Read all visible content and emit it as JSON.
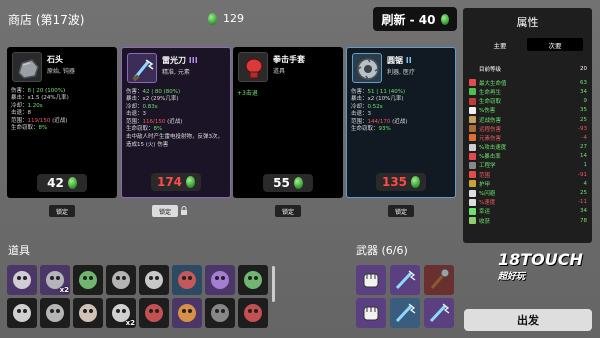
{
  "header": {
    "shop_title": "商店 (第17波)",
    "materials": "129",
    "reroll_label": "刷新 - 40"
  },
  "cards": [
    {
      "name": "石头",
      "tier": "",
      "tags": "原始, 钝器",
      "stats": [
        {
          "k": "伤害：",
          "v": "8 | 20",
          "tag": "(",
          "extra": "100%",
          "tail": ")"
        },
        {
          "k": "暴击：",
          "v": "x1.5",
          "extra": "(24%几率)"
        },
        {
          "k": "冷却：",
          "v": "1.20s"
        },
        {
          "k": "击退：",
          "v": "8"
        },
        {
          "k": "范围：",
          "v": "119/150",
          "extra": "(近战)"
        },
        {
          "k": "生命窃取：",
          "v": "8%"
        }
      ],
      "price": "42",
      "price_red": false,
      "lock": "锁定"
    },
    {
      "name": "雷光刀",
      "tier": "III",
      "tags": "精准, 元素",
      "stats": [
        {
          "k": "伤害：",
          "v": "42 | 80",
          "extra": "(80%)"
        },
        {
          "k": "暴击：",
          "v": "x2",
          "extra": "(29%几率)"
        },
        {
          "k": "冷却：",
          "v": "0.83s"
        },
        {
          "k": "击退：",
          "v": "3"
        },
        {
          "k": "范围：",
          "v": "116/150",
          "extra": "(近战)"
        },
        {
          "k": "生命窃取：",
          "v": "8%"
        }
      ],
      "desc": "击中敌人时产生雷电投射物，反弹3次，造成15 (火) 伤害",
      "price": "174",
      "price_red": true,
      "lock": "锁定"
    },
    {
      "name": "拳击手套",
      "tier": "",
      "tags": "道具",
      "single_stat": "+3击退",
      "price": "55",
      "price_red": false,
      "lock": "锁定"
    },
    {
      "name": "圆锯",
      "tier": "II",
      "tags": "利器, 医疗",
      "stats": [
        {
          "k": "伤害：",
          "v": "51 | 11",
          "extra": "(40%)"
        },
        {
          "k": "暴击：",
          "v": "x2",
          "extra": "(10%几率)"
        },
        {
          "k": "冷却：",
          "v": "0.52s"
        },
        {
          "k": "击退：",
          "v": "3"
        },
        {
          "k": "范围：",
          "v": "144/170",
          "extra": "(近战)"
        },
        {
          "k": "生命窃取：",
          "v": "93%"
        }
      ],
      "price": "135",
      "price_red": true,
      "lock": "锁定"
    }
  ],
  "items_section": {
    "label": "道具",
    "slots": [
      {
        "icon": "axe-icon",
        "qty": ""
      },
      {
        "icon": "cube-icon",
        "qty": "x2"
      },
      {
        "icon": "zombie-icon",
        "qty": ""
      },
      {
        "icon": "ghost-icon",
        "qty": ""
      },
      {
        "icon": "palm-icon",
        "qty": ""
      },
      {
        "icon": "horns-icon",
        "qty": ""
      },
      {
        "icon": "demon-icon",
        "qty": ""
      },
      {
        "icon": "snake-icon",
        "qty": ""
      },
      {
        "icon": "coffee-icon",
        "qty": ""
      },
      {
        "icon": "helmet-icon",
        "qty": ""
      },
      {
        "icon": "claw-icon",
        "qty": ""
      },
      {
        "icon": "eye-icon",
        "qty": "x2"
      },
      {
        "icon": "cap-icon",
        "qty": ""
      },
      {
        "icon": "starfish-icon",
        "qty": ""
      },
      {
        "icon": "anvil-icon",
        "qty": ""
      },
      {
        "icon": "brain-icon",
        "qty": ""
      }
    ]
  },
  "weapons_section": {
    "label": "武器 (6/6)",
    "slots": [
      {
        "icon": "fist-icon",
        "tier": "purple"
      },
      {
        "icon": "lightning-blade-icon",
        "tier": "purple"
      },
      {
        "icon": "rock-club-icon",
        "tier": "red"
      },
      {
        "icon": "fist-icon",
        "tier": "purple"
      },
      {
        "icon": "lightning-blade-icon",
        "tier": "blue"
      },
      {
        "icon": "lightning-blade-icon",
        "tier": "purple"
      }
    ]
  },
  "watermark": {
    "line1": "18TOUCH",
    "line2": "超好玩"
  },
  "go_label": "出发",
  "panel": {
    "title": "属性",
    "tab_main": "主要",
    "tab_sub": "次要",
    "stats": [
      {
        "label": "目前等级",
        "value": "20",
        "kind": "neu",
        "color": "#dddddd"
      },
      {
        "label": "最大生命值",
        "value": "63",
        "kind": "pos",
        "color": "#e24c4c"
      },
      {
        "label": "生命再生",
        "value": "34",
        "kind": "pos",
        "color": "#4fbf4f"
      },
      {
        "label": "生命窃取",
        "value": "9",
        "kind": "pos",
        "color": "#c23a3a"
      },
      {
        "label": "%伤害",
        "value": "35",
        "kind": "pos",
        "color": "#f0f0f0"
      },
      {
        "label": "近战伤害",
        "value": "25",
        "kind": "pos",
        "color": "#c8a060"
      },
      {
        "label": "远程伤害",
        "value": "-93",
        "kind": "neg",
        "color": "#b06a3a"
      },
      {
        "label": "元素伤害",
        "value": "-4",
        "kind": "neg",
        "color": "#e07030"
      },
      {
        "label": "%攻击速度",
        "value": "27",
        "kind": "pos",
        "color": "#cfcfcf"
      },
      {
        "label": "%暴击率",
        "value": "14",
        "kind": "pos",
        "color": "#e24c4c"
      },
      {
        "label": "工程学",
        "value": "1",
        "kind": "pos",
        "color": "#888888"
      },
      {
        "label": "范围",
        "value": "-91",
        "kind": "neg",
        "color": "#e24c4c"
      },
      {
        "label": "护甲",
        "value": "4",
        "kind": "pos",
        "color": "#c9a530"
      },
      {
        "label": "%闪避",
        "value": "25",
        "kind": "pos",
        "color": "#e0e0e0"
      },
      {
        "label": "%速度",
        "value": "-11",
        "kind": "neg",
        "color": "#dddddd"
      },
      {
        "label": "幸运",
        "value": "34",
        "kind": "pos",
        "color": "#6de36d"
      },
      {
        "label": "收获",
        "value": "78",
        "kind": "pos",
        "color": "#8ed06a"
      }
    ]
  }
}
